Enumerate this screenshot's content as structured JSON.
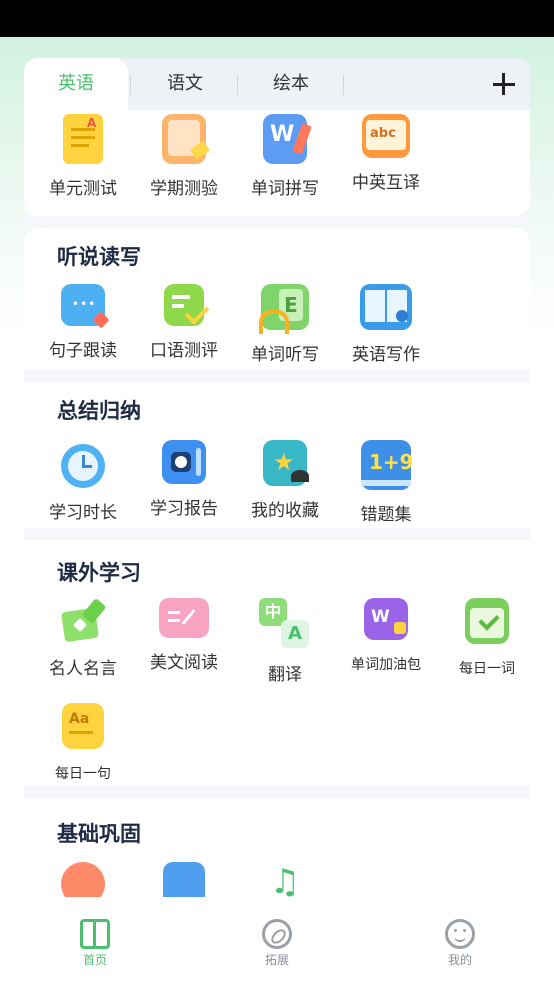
{
  "tabs": [
    {
      "label": "英语",
      "active": true
    },
    {
      "label": "语文",
      "active": false
    },
    {
      "label": "绘本",
      "active": false
    }
  ],
  "add_tab_icon": "plus-icon",
  "top_items": [
    {
      "label": "单元测试",
      "icon": "unit-test-icon"
    },
    {
      "label": "学期测验",
      "icon": "term-quiz-icon"
    },
    {
      "label": "单词拼写",
      "icon": "word-spelling-icon"
    },
    {
      "label": "中英互译",
      "icon": "translate-abc-icon"
    }
  ],
  "sections": [
    {
      "title": "听说读写",
      "items": [
        {
          "label": "句子跟读",
          "icon": "sentence-read-icon"
        },
        {
          "label": "口语测评",
          "icon": "speaking-eval-icon"
        },
        {
          "label": "单词听写",
          "icon": "word-dictation-icon"
        },
        {
          "label": "英语写作",
          "icon": "english-writing-icon"
        }
      ]
    },
    {
      "title": "总结归纳",
      "items": [
        {
          "label": "学习时长",
          "icon": "alarm-clock-icon"
        },
        {
          "label": "学习报告",
          "icon": "report-icon"
        },
        {
          "label": "我的收藏",
          "icon": "favorites-icon"
        },
        {
          "label": "错题集",
          "icon": "mistakes-book-icon"
        }
      ]
    },
    {
      "title": "课外学习",
      "items": [
        {
          "label": "名人名言",
          "icon": "quotes-icon"
        },
        {
          "label": "美文阅读",
          "icon": "reading-icon"
        },
        {
          "label": "翻译",
          "icon": "translation-icon"
        },
        {
          "label": "单词加油包",
          "icon": "word-pack-icon"
        },
        {
          "label": "每日一词",
          "icon": "daily-word-icon"
        },
        {
          "label": "每日一句",
          "icon": "daily-sentence-icon"
        }
      ]
    },
    {
      "title": "基础巩固",
      "items": [
        {
          "label": "",
          "icon": "foundation-icon-1"
        },
        {
          "label": "",
          "icon": "foundation-icon-2"
        },
        {
          "label": "",
          "icon": "music-note-icon"
        }
      ]
    }
  ],
  "bottom_nav": [
    {
      "label": "首页",
      "icon": "book-icon",
      "active": true
    },
    {
      "label": "拓展",
      "icon": "compass-icon",
      "active": false
    },
    {
      "label": "我的",
      "icon": "smiley-icon",
      "active": false
    }
  ],
  "colors": {
    "accent": "#4cbf6e",
    "title": "#1f2a44"
  }
}
